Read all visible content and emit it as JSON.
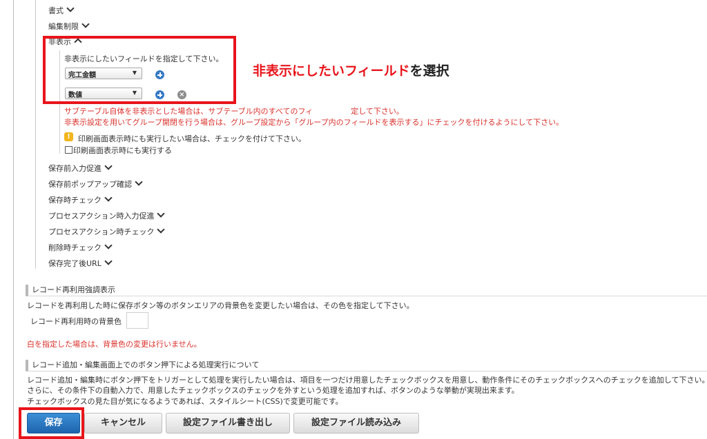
{
  "tree": {
    "items_top": [
      {
        "label": "書式"
      },
      {
        "label": "編集制限"
      }
    ],
    "hidden_section": {
      "label": "非表示",
      "instruction": "非表示にしたいフィールドを指定して下さい。",
      "fields": [
        {
          "value": "完工金額"
        },
        {
          "value": "数値"
        }
      ],
      "notes_red": [
        "サブテーブル自体を非表示とした場合は、サブテーブル内のすべてのフィ　　　　　定して下さい。",
        "非表示設定を用いてグループ開閉を行う場合は、グループ設定から「グループ内のフィールドを表示する」にチェックを付けるようにして下さい。"
      ],
      "print_notice": "印刷画面表示時にも実行したい場合は、チェックを付けて下さい。",
      "print_checkbox_label": "印刷画面表示時にも実行する"
    },
    "items_bottom": [
      {
        "label": "保存前入力促進"
      },
      {
        "label": "保存前ポップアップ確認"
      },
      {
        "label": "保存時チェック"
      },
      {
        "label": "プロセスアクション時入力促進"
      },
      {
        "label": "プロセスアクション時チェック"
      },
      {
        "label": "削除時チェック"
      },
      {
        "label": "保存完了後URL"
      }
    ]
  },
  "annotation": {
    "highlight": "非表示にしたいフィールド",
    "rest": "を選択"
  },
  "reuse": {
    "title": "レコード再利用強調表示",
    "description": "レコードを再利用した時に保存ボタン等のボタンエリアの背景色を変更したい場合は、その色を指定して下さい。",
    "bg_label": "レコード再利用時の背景色",
    "bg_value": "",
    "warning": "白を指定した場合は、背景色の変更は行いません。"
  },
  "process": {
    "title": "レコード追加・編集画面上でのボタン押下による処理実行について",
    "lines": [
      "レコード追加・編集時にボタン押下をトリガーとして処理を実行したい場合は、項目を一つだけ用意したチェックボックスを用意し、動作条件にそのチェックボックスへのチェックを追加して下さい。",
      "さらに、その条件下の自動入力で、用意したチェックボックスのチェックを外すという処理を追加すれば、ボタンのような挙動が実現出来ます。",
      "チェックボックスの見た目が気になるようであれば、スタイルシート(CSS)で変更可能です。"
    ]
  },
  "buttons": {
    "save": "保存",
    "cancel": "キャンセル",
    "export": "設定ファイル書き出し",
    "import": "設定ファイル読み込み"
  },
  "colors": {
    "accent_red": "#e8141b",
    "note_red": "#d9302b",
    "primary_blue": "#1e64ad"
  }
}
